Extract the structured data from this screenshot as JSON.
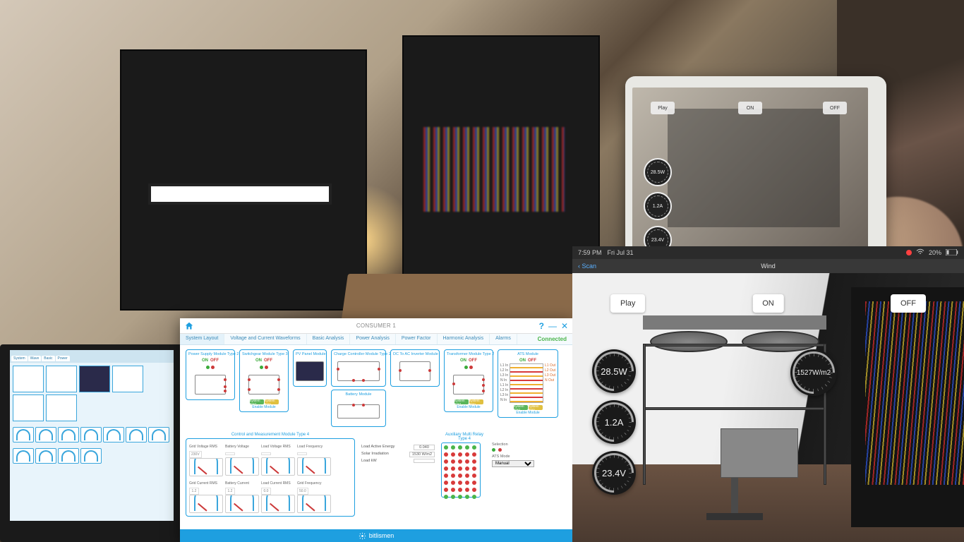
{
  "app": {
    "title": "CONSUMER 1",
    "brand": "bitlismen",
    "connection": "Connected",
    "tabs": [
      "System Layout",
      "Voltage and Current Waveforms",
      "Basic Analysis",
      "Power Analysis",
      "Power Factor",
      "Harmonic Analysis",
      "Alarms"
    ],
    "on_label": "ON",
    "off_label": "OFF",
    "enable_label": "Enable Module",
    "modules": {
      "power_supply": "Power Supply Module Type 2",
      "switchgear": "Switchgear Module Type 3",
      "pv_panel": "PV Panel Module",
      "charge_controller": "Charge Controller Module Type 2",
      "dc_ac_inverter": "DC To AC Inverter Module",
      "transformer": "Transformer Module Type 2",
      "ats": "ATS Module",
      "battery": "Battery Module",
      "control_measure": "Control and Measurement Module Type 4",
      "aux_relay": "Auxiliary Multi Relay Type 4"
    },
    "system_btns": {
      "start": "System Start",
      "stop": "System Stop"
    },
    "ats": {
      "mode_label": "ATS Mode",
      "selection": "Selection",
      "lines": [
        "L1 In",
        "L2 In",
        "L3 In",
        "N In",
        "L1 In",
        "L2 In",
        "L3 In",
        "N In"
      ],
      "outs": [
        "L1 Out",
        "L2 Out",
        "L3 Out",
        "N Out"
      ]
    },
    "gauges": [
      {
        "label": "Grid Voltage RMS",
        "value": "230V"
      },
      {
        "label": "Battery Voltage",
        "value": ""
      },
      {
        "label": "Load Voltage RMS",
        "value": ""
      },
      {
        "label": "Load Frequency",
        "value": ""
      },
      {
        "label": "Grid Current RMS",
        "value": "1.2"
      },
      {
        "label": "Battery Current",
        "value": "1.2"
      },
      {
        "label": "Load Current RMS",
        "value": "0.0"
      },
      {
        "label": "Grid Frequency",
        "value": "50.0"
      }
    ],
    "stats": {
      "load_active_energy": {
        "label": "Load Active Energy",
        "value": "0.040"
      },
      "solar_irradiation": {
        "label": "Solar Irradiation",
        "value": "1530 W/m2"
      },
      "load_kw": {
        "label": "Load kW",
        "value": ""
      }
    }
  },
  "ar": {
    "status_time": "7:59 PM",
    "status_date": "Fri Jul 31",
    "battery": "20%",
    "back": "Scan",
    "title": "Wind",
    "buttons": {
      "play": "Play",
      "on": "ON",
      "off": "OFF"
    },
    "gauges": {
      "power": "28.5W",
      "current": "1.2A",
      "voltage": "23.4V",
      "irradiance": "1527W/m2"
    }
  },
  "tablet": {
    "buttons": {
      "play": "Play",
      "on": "ON",
      "off": "OFF"
    },
    "gauges": {
      "power": "28.5W",
      "current": "1.2A",
      "voltage": "23.4V"
    }
  }
}
